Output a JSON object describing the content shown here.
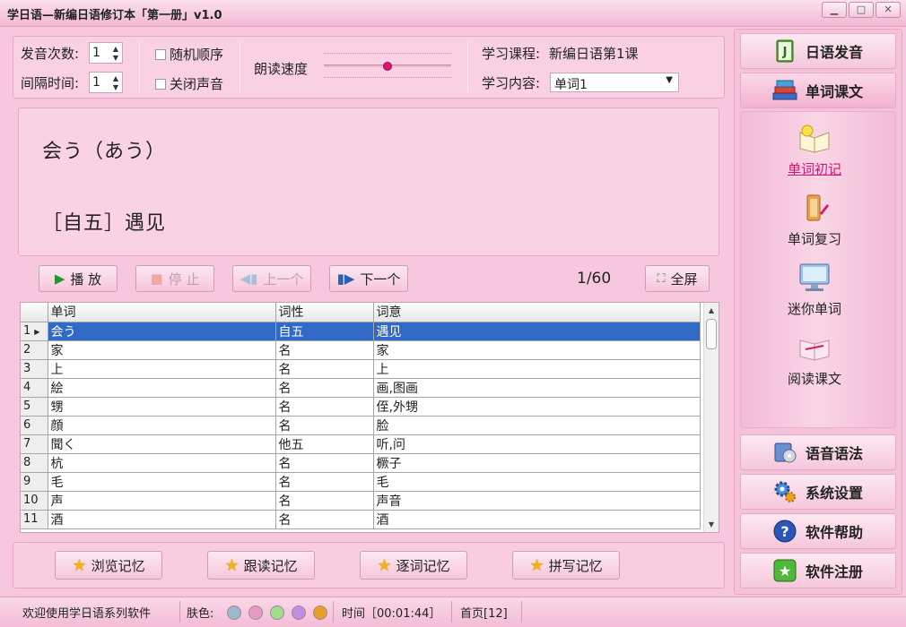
{
  "window": {
    "title": "学日语—新编日语修订本「第一册」v1.0",
    "controls": [
      "▁",
      "□",
      "✕"
    ]
  },
  "settings": {
    "pronounce_count_label": "发音次数:",
    "pronounce_count_value": "1",
    "interval_label": "间隔时间:",
    "interval_value": "1",
    "random_order_label": "随机顺序",
    "mute_label": "关闭声音",
    "speed_label": "朗读速度",
    "speed_level": 0.5,
    "course_label": "学习课程:",
    "course_value": "新编日语第1课",
    "content_label": "学习内容:",
    "content_value": "单词1"
  },
  "display": {
    "line1": "会う（あう）",
    "line2": "［自五］遇见"
  },
  "player": {
    "play_label": "播 放",
    "stop_label": "停 止",
    "prev_label": "上一个",
    "next_label": "下一个",
    "counter": "1/60",
    "fullscreen_label": "全屏"
  },
  "table": {
    "columns": [
      "单词",
      "词性",
      "词意"
    ],
    "rows": [
      {
        "num": "1",
        "word": "会う",
        "pos": "自五",
        "meaning": "遇见",
        "selected": true
      },
      {
        "num": "2",
        "word": "家",
        "pos": "名",
        "meaning": "家"
      },
      {
        "num": "3",
        "word": "上",
        "pos": "名",
        "meaning": "上"
      },
      {
        "num": "4",
        "word": "絵",
        "pos": "名",
        "meaning": "画,图画"
      },
      {
        "num": "5",
        "word": "甥",
        "pos": "名",
        "meaning": "侄,外甥"
      },
      {
        "num": "6",
        "word": "顔",
        "pos": "名",
        "meaning": "脸"
      },
      {
        "num": "7",
        "word": "聞く",
        "pos": "他五",
        "meaning": "听,问"
      },
      {
        "num": "8",
        "word": "杭",
        "pos": "名",
        "meaning": "橛子"
      },
      {
        "num": "9",
        "word": "毛",
        "pos": "名",
        "meaning": "毛"
      },
      {
        "num": "10",
        "word": "声",
        "pos": "名",
        "meaning": "声音"
      },
      {
        "num": "11",
        "word": "酒",
        "pos": "名",
        "meaning": "酒"
      }
    ]
  },
  "memory_buttons": [
    "浏览记忆",
    "跟读记忆",
    "逐词记忆",
    "拼写记忆"
  ],
  "status": {
    "welcome": "欢迎使用学日语系列软件",
    "skin_label": "肤色:",
    "skin_colors": [
      "#9bb8cc",
      "#e59bc4",
      "#9fdc8c",
      "#c28de0",
      "#e6a02a"
    ],
    "time": "时间［00:01:44］",
    "page": "首页[12]"
  },
  "nav": {
    "pronunciation": "日语发音",
    "word_text": "单词课文",
    "sub_items": [
      "单词初记",
      "单词复习",
      "迷你单词",
      "阅读课文"
    ],
    "grammar": "语音语法",
    "settings": "系统设置",
    "help": "软件帮助",
    "register": "软件注册"
  }
}
